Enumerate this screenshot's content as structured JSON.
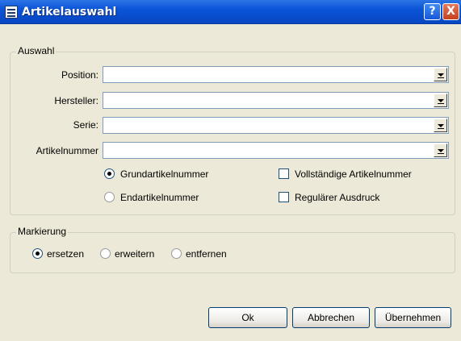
{
  "window": {
    "title": "Artikelauswahl",
    "help_icon": "?",
    "close_icon": "X"
  },
  "auswahl": {
    "legend": "Auswahl",
    "fields": [
      {
        "label": "Position:",
        "value": ""
      },
      {
        "label": "Hersteller:",
        "value": ""
      },
      {
        "label": "Serie:",
        "value": ""
      },
      {
        "label": "Artikelnummer",
        "value": ""
      }
    ],
    "radio_grund": {
      "label": "Grundartikelnummer",
      "checked": true
    },
    "radio_end": {
      "label": "Endartikelnummer",
      "checked": false
    },
    "check_vollstaendig": {
      "label": "Vollständige Artikelnummer",
      "checked": false
    },
    "check_regulaer": {
      "label": "Regulärer Ausdruck",
      "checked": false
    }
  },
  "markierung": {
    "legend": "Markierung",
    "options": [
      {
        "label": "ersetzen",
        "checked": true
      },
      {
        "label": "erweitern",
        "checked": false
      },
      {
        "label": "entfernen",
        "checked": false
      }
    ]
  },
  "buttons": {
    "ok": "Ok",
    "cancel": "Abbrechen",
    "apply": "Übernehmen"
  }
}
